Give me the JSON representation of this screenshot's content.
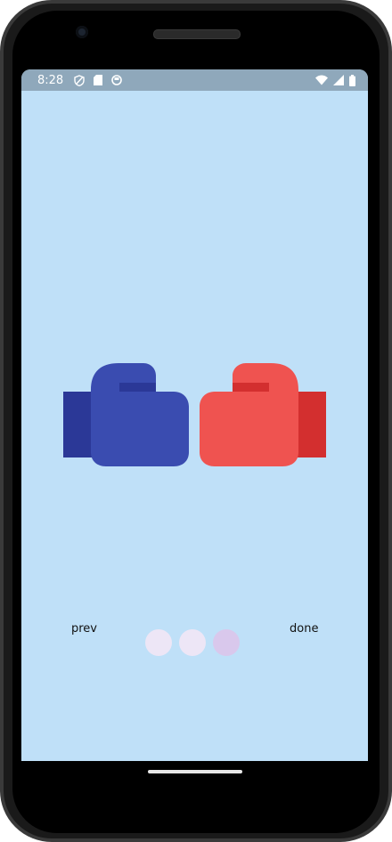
{
  "status_bar": {
    "time": "8:28",
    "left_icons": [
      "shield-icon",
      "sd-card-icon",
      "sync-icon"
    ],
    "right_icons": [
      "wifi-icon",
      "cell-signal-icon",
      "battery-icon"
    ]
  },
  "illustration": {
    "name": "boxing-gloves",
    "left_glove_color": "#3a4cb0",
    "left_glove_cuff_color": "#2b3897",
    "right_glove_color": "#ef5350",
    "right_glove_cuff_color": "#d32f2f"
  },
  "navigation": {
    "prev_label": "prev",
    "done_label": "done"
  },
  "page_indicator": {
    "count": 3,
    "active_index": 2,
    "colors": [
      "#ede6f6",
      "#ede6f6",
      "#d9c8ec"
    ]
  },
  "colors": {
    "background": "#bfe0f8",
    "status_bar": "#8fa8bb"
  }
}
